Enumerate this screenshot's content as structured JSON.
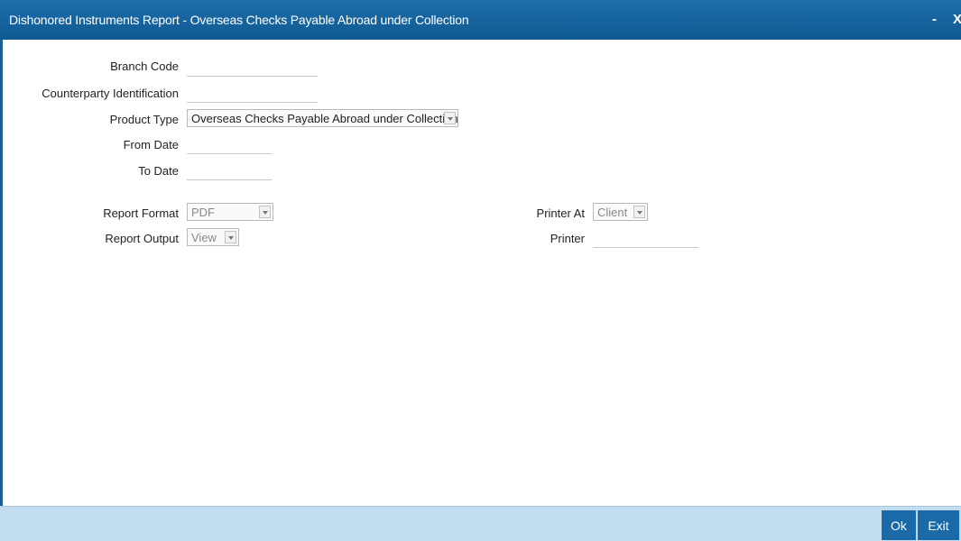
{
  "window": {
    "title": "Dishonored Instruments Report - Overseas Checks Payable Abroad under Collection",
    "minimize_label": "-",
    "close_label": "X"
  },
  "form": {
    "branch_code": {
      "label": "Branch Code",
      "value": ""
    },
    "counterparty_identification": {
      "label": "Counterparty Identification",
      "value": ""
    },
    "product_type": {
      "label": "Product Type",
      "value": "Overseas Checks Payable Abroad under Collection"
    },
    "from_date": {
      "label": "From Date",
      "value": ""
    },
    "to_date": {
      "label": "To Date",
      "value": ""
    },
    "report_format": {
      "label": "Report Format",
      "value": "PDF"
    },
    "report_output": {
      "label": "Report Output",
      "value": "View"
    },
    "printer_at": {
      "label": "Printer At",
      "value": "Client"
    },
    "printer": {
      "label": "Printer",
      "value": ""
    }
  },
  "footer": {
    "ok_label": "Ok",
    "exit_label": "Exit"
  },
  "colors": {
    "titlebar": "#0f5a92",
    "footer": "#c2dcf0",
    "button": "#1a6aa8"
  }
}
